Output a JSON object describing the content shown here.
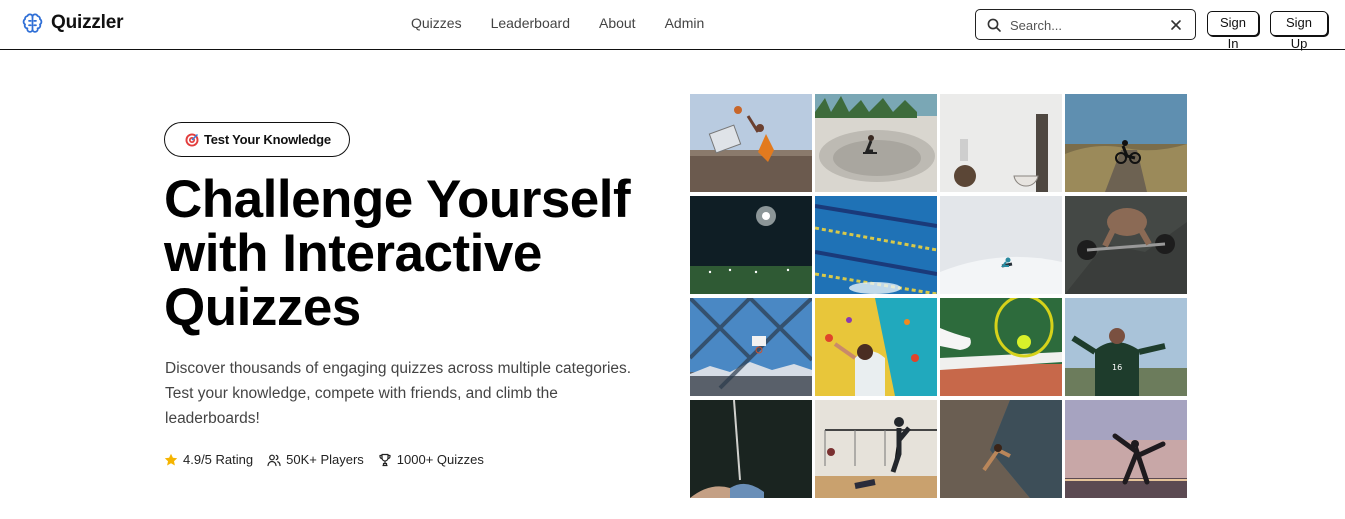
{
  "header": {
    "brand": "Quizzler",
    "nav": [
      "Quizzes",
      "Leaderboard",
      "About",
      "Admin"
    ],
    "search_placeholder": "Search...",
    "sign_in": "Sign In",
    "sign_up": "Sign Up"
  },
  "hero": {
    "badge": "Test Your Knowledge",
    "title_line1": "Challenge Yourself",
    "title_line2": "with Interactive",
    "title_line3": "Quizzes",
    "description": "Discover thousands of engaging quizzes across multiple categories. Test your knowledge, compete with friends, and climb the leaderboards!",
    "stats": [
      {
        "icon": "star-icon",
        "label": "4.9/5 Rating"
      },
      {
        "icon": "users-icon",
        "label": "50K+ Players"
      },
      {
        "icon": "trophy-icon",
        "label": "1000+ Quizzes"
      }
    ]
  },
  "gallery": [
    "basketball-dunk-photo",
    "skatepark-photo",
    "basketball-hoop-photo",
    "mountain-biker-photo",
    "night-stadium-photo",
    "swimming-pool-photo",
    "snowboarder-photo",
    "weightlifting-photo",
    "chainlink-fence-photo",
    "climbing-wall-photo",
    "tennis-racket-photo",
    "soccer-player-photo",
    "fencing-photo",
    "volleyball-photo",
    "rock-climber-photo",
    "yoga-sunset-photo"
  ],
  "colors": {
    "brand_icon": "#2f6fd6",
    "text": "#111111",
    "muted": "#444444",
    "star": "#f5b400"
  }
}
